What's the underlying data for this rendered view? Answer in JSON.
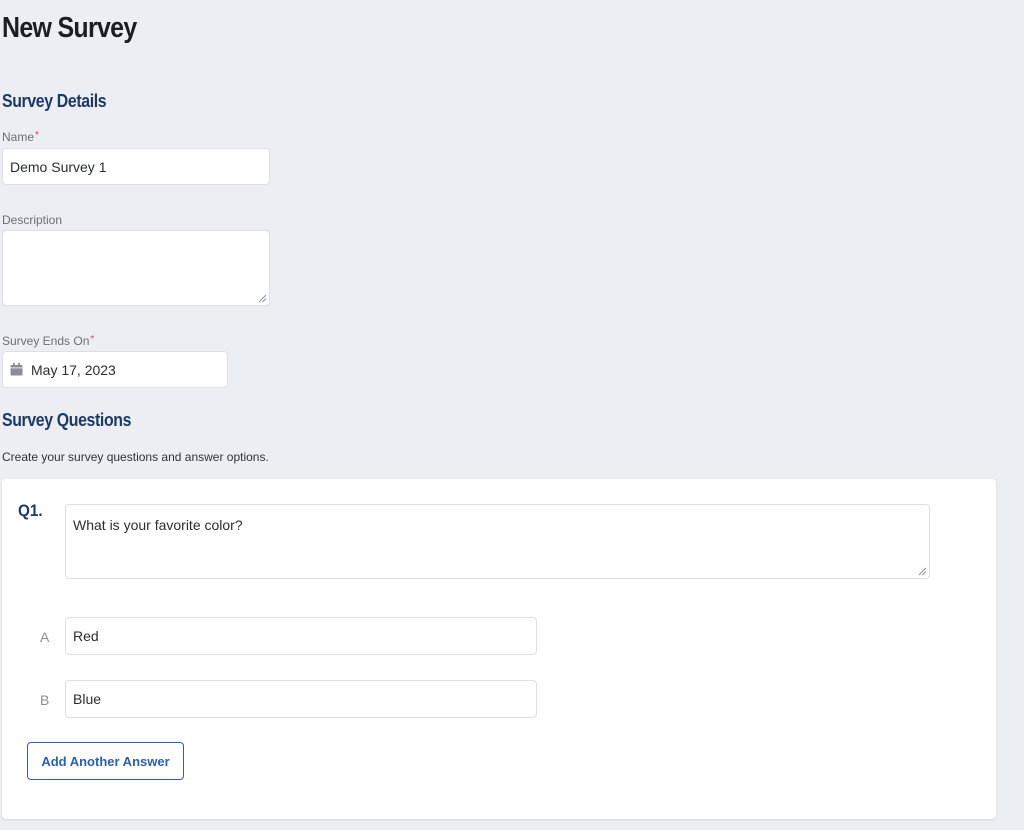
{
  "page": {
    "title": "New Survey"
  },
  "details": {
    "section_title": "Survey Details",
    "name_label": "Name",
    "name_value": "Demo Survey 1",
    "description_label": "Description",
    "description_value": "",
    "ends_on_label": "Survey Ends On",
    "ends_on_value": "May 17, 2023",
    "required_mark": "*"
  },
  "questions": {
    "section_title": "Survey Questions",
    "helper_text": "Create your survey questions and answer options.",
    "items": [
      {
        "number": "Q1.",
        "text": "What is your favorite color?",
        "answers": [
          {
            "letter": "A",
            "value": "Red"
          },
          {
            "letter": "B",
            "value": "Blue"
          }
        ]
      }
    ],
    "add_answer_label": "Add Another Answer"
  },
  "icons": {
    "date": "calendar-icon",
    "resize": "resize-handle-icon"
  },
  "colors": {
    "accent": "#1b3a66",
    "button": "#2f5fa8",
    "required": "#e0434b",
    "background": "#edeef3"
  }
}
